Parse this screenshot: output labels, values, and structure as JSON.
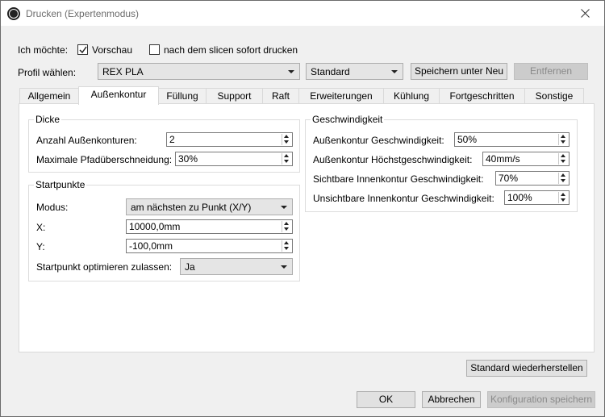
{
  "window": {
    "title": "Drucken (Expertenmodus)"
  },
  "top": {
    "want_label": "Ich möchte:",
    "preview_label": "Vorschau",
    "preview_checked": true,
    "print_after_slice_label": "nach dem slicen sofort drucken",
    "print_after_slice_checked": false,
    "profile_label": "Profil wählen:",
    "profile_value": "REX PLA",
    "quality_value": "Standard",
    "save_as_new_label": "Speichern unter Neu",
    "remove_label": "Entfernen"
  },
  "tabs": [
    {
      "label": "Allgemein"
    },
    {
      "label": "Außenkontur"
    },
    {
      "label": "Füllung"
    },
    {
      "label": "Support"
    },
    {
      "label": "Raft"
    },
    {
      "label": "Erweiterungen"
    },
    {
      "label": "Kühlung"
    },
    {
      "label": "Fortgeschritten"
    },
    {
      "label": "Sonstige"
    }
  ],
  "dicke": {
    "title": "Dicke",
    "outer_count_label": "Anzahl Außenkonturen:",
    "outer_count_value": "2",
    "max_overlap_label": "Maximale Pfadüberschneidung:",
    "max_overlap_value": "30%"
  },
  "startpunkte": {
    "title": "Startpunkte",
    "mode_label": "Modus:",
    "mode_value": "am nächsten zu Punkt (X/Y)",
    "x_label": "X:",
    "x_value": "10000,0mm",
    "y_label": "Y:",
    "y_value": "-100,0mm",
    "optimize_label": "Startpunkt optimieren zulassen:",
    "optimize_value": "Ja"
  },
  "geschwindigkeit": {
    "title": "Geschwindigkeit",
    "outer_speed_label": "Außenkontur Geschwindigkeit:",
    "outer_speed_value": "50%",
    "outer_max_label": "Außenkontur Höchstgeschwindigkeit:",
    "outer_max_value": "40mm/s",
    "visible_inner_label": "Sichtbare Innenkontur Geschwindigkeit:",
    "visible_inner_value": "70%",
    "invisible_inner_label": "Unsichtbare Innenkontur Geschwindigkeit:",
    "invisible_inner_value": "100%"
  },
  "footer": {
    "restore_label": "Standard wiederherstellen",
    "ok_label": "OK",
    "cancel_label": "Abbrechen",
    "save_config_label": "Konfiguration speichern"
  }
}
